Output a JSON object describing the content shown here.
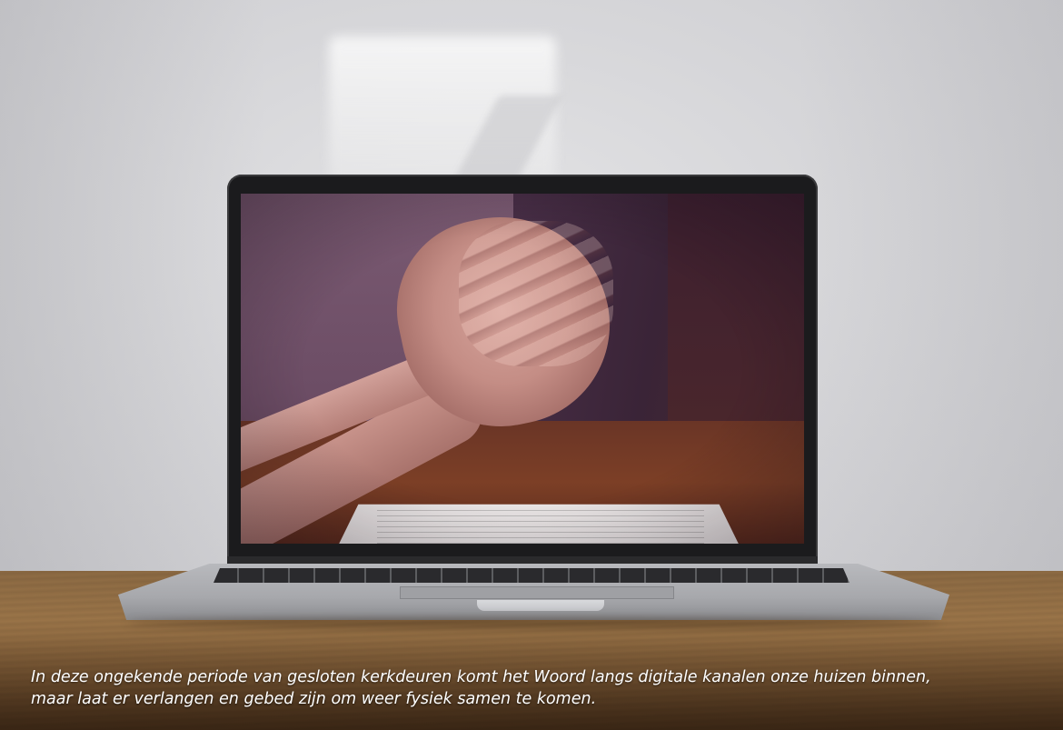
{
  "caption": {
    "line1": "In deze ongekende periode van gesloten kerkdeuren komt het Woord langs digitale kanalen onze huizen binnen,",
    "line2": "maar laat er verlangen en gebed zijn om weer fysiek samen te komen."
  },
  "colors": {
    "wall": "#d6d6d9",
    "table": "#8c6a43",
    "screen_tint": "#5a3f57",
    "caption_text": "#ffffff"
  }
}
